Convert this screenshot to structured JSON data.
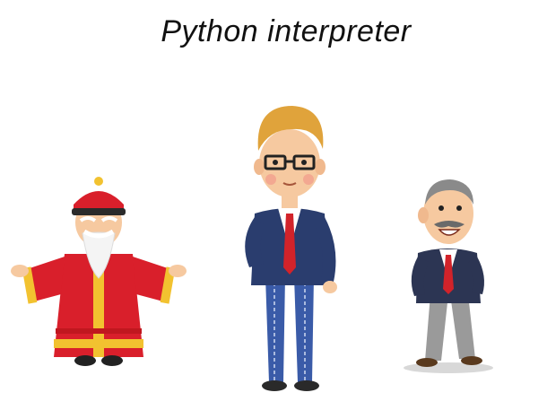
{
  "slide": {
    "title": "Python interpreter"
  },
  "figures": [
    {
      "icon": "old-sage-character-icon"
    },
    {
      "icon": "young-man-glasses-character-icon"
    },
    {
      "icon": "old-man-mustache-character-icon"
    }
  ],
  "colors": {
    "robe_red": "#d91f2b",
    "robe_gold": "#f2c230",
    "suit_navy": "#2a3d6e",
    "pants_blue": "#3a5ba8",
    "tie_red": "#d2232a",
    "hair_blonde": "#e0a33b",
    "jacket_dark_navy": "#2c3553",
    "pants_gray": "#9a9a9a"
  }
}
